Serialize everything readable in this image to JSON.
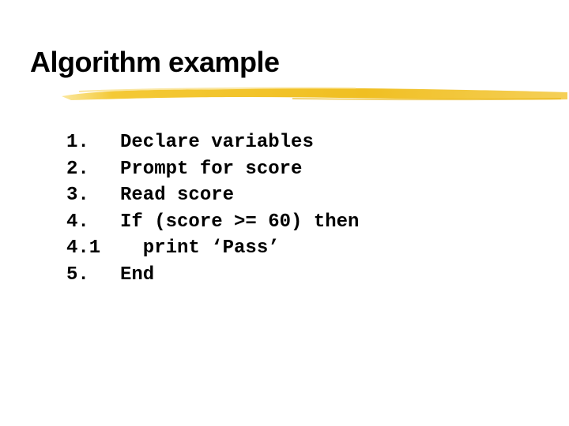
{
  "slide": {
    "title": "Algorithm example",
    "accent_color": "#f2c12e",
    "steps": [
      {
        "number": "1.",
        "text": "Declare variables"
      },
      {
        "number": "2.",
        "text": "Prompt for score"
      },
      {
        "number": "3.",
        "text": "Read score"
      },
      {
        "number": "4.",
        "text": "If (score >= 60) then"
      },
      {
        "number": "4.1",
        "text": "  print ‘Pass’"
      },
      {
        "number": "5.",
        "text": "End"
      }
    ]
  }
}
